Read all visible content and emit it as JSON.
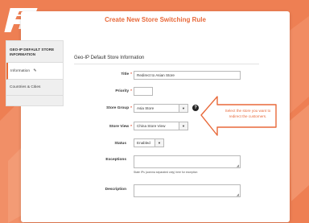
{
  "page": {
    "title": "Create New Store Switching Rule"
  },
  "sidebar": {
    "header": "GEO-IP DEFAULT STORE INFORMATION",
    "items": [
      {
        "label": "Information",
        "active": true
      },
      {
        "label": "Countries & Cities",
        "active": false
      }
    ]
  },
  "form": {
    "section_title": "Geo-IP Default Store Information",
    "title_label": "Title",
    "title_value": "Redirect to Asian Store",
    "priority_label": "Priority",
    "priority_value": "",
    "store_group_label": "Store Group",
    "store_group_value": "Asia Store",
    "store_view_label": "Store View",
    "store_view_value": "China Store View",
    "status_label": "Status",
    "status_value": "Enabled",
    "exceptions_label": "Exceptions",
    "exceptions_value": "",
    "exceptions_note": "State IPs (comma separated only) here for exception",
    "description_label": "Description",
    "description_value": "",
    "required_marker": "*",
    "help_icon": "question-icon"
  },
  "callout": {
    "text": "Select the store you want to redirect the customers."
  },
  "icons": {
    "logo": "fme-logo",
    "edit": "pencil-icon",
    "dropdown": "caret-down-icon"
  },
  "colors": {
    "background": "#ee7f53",
    "accent": "#e8693a",
    "required": "#e04b2d"
  }
}
